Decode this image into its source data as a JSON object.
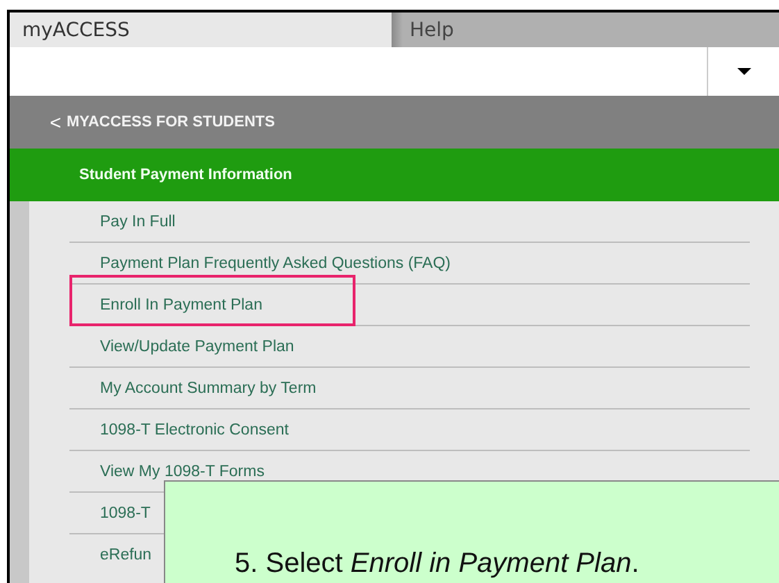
{
  "top_menu": [
    {
      "label": "myACCESS",
      "selected": true
    },
    {
      "label": "Help",
      "selected": false
    }
  ],
  "header": {
    "back_icon": "<",
    "title": "MYACCESS FOR STUDENTS"
  },
  "section": {
    "title": "Student Payment Information"
  },
  "menu_items": [
    {
      "label": "Pay In Full",
      "highlighted": false
    },
    {
      "label": "Payment Plan Frequently Asked Questions (FAQ)",
      "highlighted": false
    },
    {
      "label": "Enroll In Payment Plan",
      "highlighted": true
    },
    {
      "label": "View/Update Payment Plan",
      "highlighted": false
    },
    {
      "label": "My Account Summary by Term",
      "highlighted": false
    },
    {
      "label": "1098-T Electronic Consent",
      "highlighted": false
    },
    {
      "label": "View My 1098-T Forms",
      "highlighted": false
    },
    {
      "label": "1098-T",
      "highlighted": false
    },
    {
      "label": "eRefun",
      "highlighted": false
    }
  ],
  "callout": {
    "text": "5. Select *Enroll in Payment Plan*."
  }
}
